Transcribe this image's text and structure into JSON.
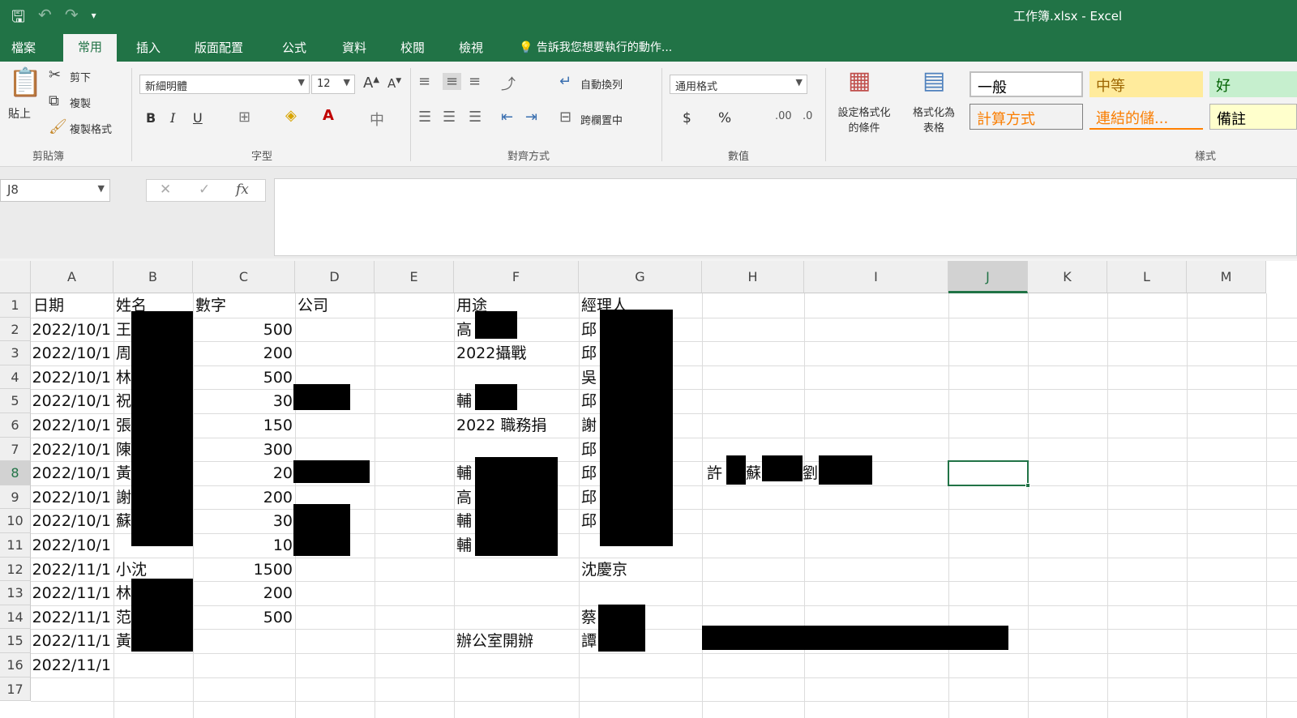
{
  "window": {
    "title": "工作簿.xlsx - Excel"
  },
  "qat": {
    "save_icon": "save-icon",
    "undo_icon": "undo-icon",
    "redo_icon": "redo-icon"
  },
  "tabs": [
    "檔案",
    "常用",
    "插入",
    "版面配置",
    "公式",
    "資料",
    "校閱",
    "檢視"
  ],
  "tell_me": "告訴我您想要執行的動作...",
  "ribbon": {
    "clipboard": {
      "paste": "貼上",
      "cut": "剪下",
      "copy": "複製",
      "format_painter": "複製格式",
      "label": "剪貼簿"
    },
    "font": {
      "name": "新細明體",
      "size": "12",
      "bold": "B",
      "italic": "I",
      "underline": "U",
      "label": "字型"
    },
    "alignment": {
      "wrap": "自動換列",
      "merge": "跨欄置中",
      "label": "對齊方式"
    },
    "number": {
      "format": "通用格式",
      "currency": "$",
      "percent": "%",
      "label": "數值"
    },
    "styles": {
      "conditional": [
        "設定格式化",
        "的條件"
      ],
      "as_table": [
        "格式化為",
        "表格"
      ],
      "cells": [
        "一般",
        "中等",
        "好",
        "計算方式",
        "連結的儲...",
        "備註"
      ],
      "label": "樣式"
    }
  },
  "formula_bar": {
    "name_box": "J8",
    "cancel": "✕",
    "enter": "✓",
    "fx": "fx",
    "content": ""
  },
  "columns": [
    "A",
    "B",
    "C",
    "D",
    "E",
    "F",
    "G",
    "H",
    "I",
    "J",
    "K",
    "L",
    "M"
  ],
  "rows": [
    "1",
    "2",
    "3",
    "4",
    "5",
    "6",
    "7",
    "8",
    "9",
    "10",
    "11",
    "12",
    "13",
    "14",
    "15",
    "16",
    "17"
  ],
  "cells": {
    "A1": "日期",
    "B1": "姓名",
    "C1": "數字",
    "D1": "公司",
    "F1": "用途",
    "G1": "經理人",
    "A2": "2022/10/1",
    "B2": "王",
    "C2": "500",
    "F2": "高",
    "G2": "邱",
    "A3": "2022/10/1",
    "B3": "周",
    "C3": "200",
    "F3": "2022攝戰",
    "G3": "邱",
    "A4": "2022/10/1",
    "B4": "林",
    "C4": "500",
    "G4": "吳",
    "A5": "2022/10/1",
    "B5": "祝",
    "C5": "30",
    "F5": "輔",
    "G5": "邱",
    "A6": "2022/10/1",
    "B6": "張",
    "C6": "150",
    "F6": "2022 職務捐",
    "G6": "謝",
    "A7": "2022/10/1",
    "B7": "陳",
    "C7": "300",
    "G7": "邱",
    "A8": "2022/10/1",
    "B8": "黃",
    "C8": "20",
    "F8": "輔",
    "G8": "邱",
    "H8a": "許",
    "H8b": "蘇",
    "H8c": "劉",
    "A9": "2022/10/1",
    "B9": "謝",
    "C9": "200",
    "F9": "高",
    "G9": "邱",
    "A10": "2022/10/1",
    "B10": "蘇",
    "C10": "30",
    "F10": "輔",
    "G10": "邱",
    "A11": "2022/10/1",
    "C11": "10",
    "F11": "輔",
    "A12": "2022/11/1",
    "B12": "小沈",
    "C12": "1500",
    "G12": "沈慶京",
    "A13": "2022/11/1",
    "B13": "林",
    "C13": "200",
    "A14": "2022/11/1",
    "B14": "范",
    "C14": "500",
    "G14": "蔡",
    "A15": "2022/11/1",
    "B15": "黃",
    "F15": "辦公室開辦",
    "G15": "譚",
    "A16": "2022/11/1"
  },
  "colors": {
    "excel_green": "#217346",
    "style_neutral": "#ffeb9c",
    "style_good": "#c6efce",
    "style_calc_text": "#fa7d00",
    "redaction": "#000000"
  }
}
